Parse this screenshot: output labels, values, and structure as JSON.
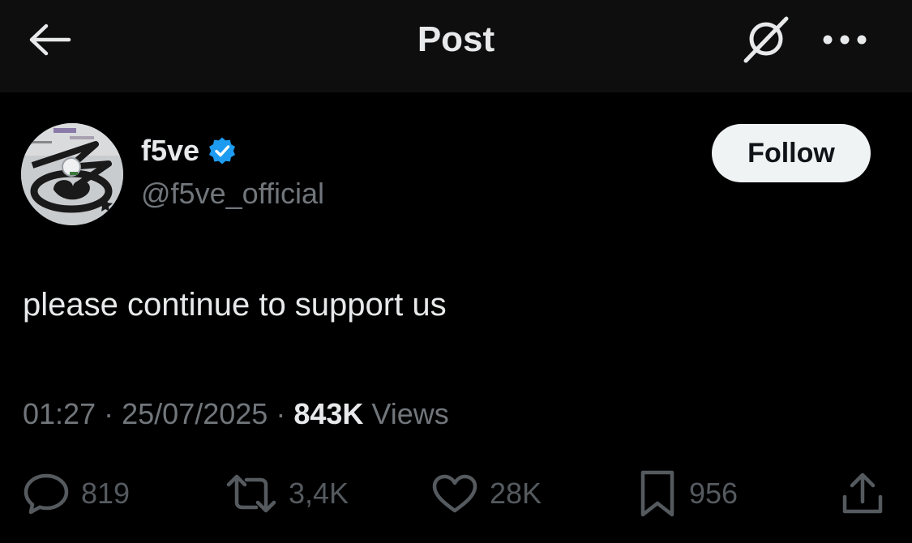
{
  "header": {
    "title": "Post",
    "back_icon": "arrow-left-icon",
    "grok_icon": "grok-icon",
    "more_icon": "more-horizontal-icon"
  },
  "author": {
    "display_name": "f5ve",
    "handle": "@f5ve_official",
    "verified": true,
    "verified_color": "#1d9bf0",
    "avatar_icon": "avatar-image"
  },
  "follow_button": {
    "label": "Follow"
  },
  "post": {
    "text": "please continue to support us",
    "time": "01:27",
    "separator": "·",
    "date": "25/07/2025",
    "views_count": "843K",
    "views_label": "Views"
  },
  "actions": {
    "replies": "819",
    "reposts": "3,4K",
    "likes": "28K",
    "bookmarks": "956"
  },
  "colors": {
    "background": "#000000",
    "header_background": "#0e0e0e",
    "text_primary": "#e7e9ea",
    "text_secondary": "#71767b",
    "action_color": "#555a5f",
    "follow_bg": "#eff3f4",
    "follow_text": "#0f1419"
  }
}
